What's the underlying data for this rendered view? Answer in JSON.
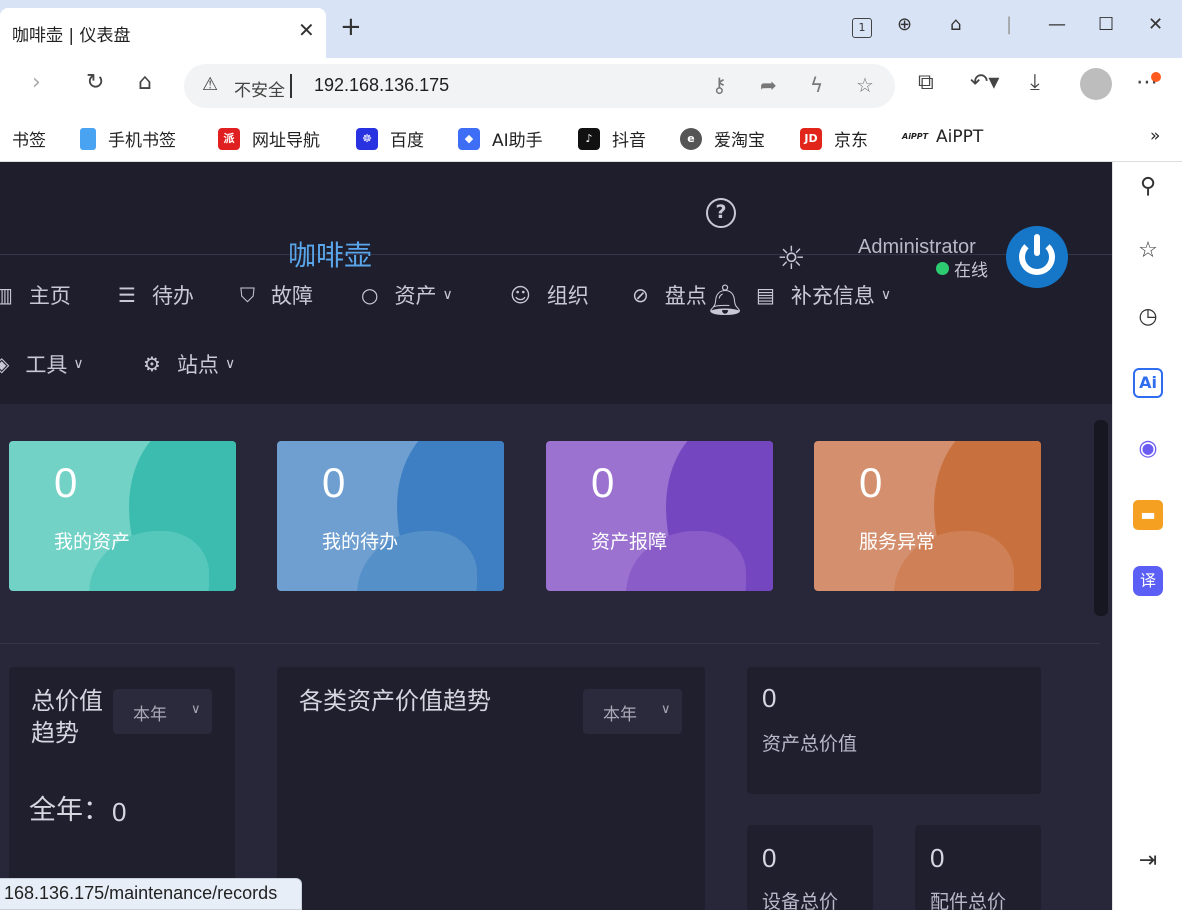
{
  "browser": {
    "tab_title": "咖啡壶 | 仪表盘",
    "tab_close": "✕",
    "new_tab": "+",
    "security_label": "不安全",
    "url": "192.168.136.175",
    "status_url": "168.136.175/maintenance/records",
    "bookmarks": [
      {
        "label": "书签",
        "icon": "",
        "color": ""
      },
      {
        "label": "手机书签",
        "icon": "phone-icon",
        "color": "#4aa3f0"
      },
      {
        "label": "网址导航",
        "icon": "nav-icon",
        "color": "#e02020"
      },
      {
        "label": "百度",
        "icon": "baidu-icon",
        "color": "#2932e1"
      },
      {
        "label": "AI助手",
        "icon": "ai-icon",
        "color": "#3d6ef5"
      },
      {
        "label": "抖音",
        "icon": "douyin-icon",
        "color": "#111111"
      },
      {
        "label": "爱淘宝",
        "icon": "taobao-icon",
        "color": "#555555"
      },
      {
        "label": "京东",
        "icon": "jd-icon",
        "color": "#e1251b"
      },
      {
        "label": "AiPPT",
        "icon": "aippt-icon",
        "color": "#222222"
      }
    ],
    "bookmarks_more": "»"
  },
  "app": {
    "logo": "咖啡壶",
    "user_name": "Administrator",
    "user_status": "在线",
    "nav": [
      {
        "label": "主页",
        "icon": "bar-chart-icon",
        "caret": false
      },
      {
        "label": "待办",
        "icon": "list-icon",
        "caret": false
      },
      {
        "label": "故障",
        "icon": "shield-icon",
        "caret": false
      },
      {
        "label": "资产",
        "icon": "circle-icon",
        "caret": true
      },
      {
        "label": "组织",
        "icon": "user-check-icon",
        "caret": false
      },
      {
        "label": "盘点",
        "icon": "check-circle-icon",
        "caret": false
      },
      {
        "label": "补充信息",
        "icon": "file-text-icon",
        "caret": true
      },
      {
        "label": "工具",
        "icon": "layers-icon",
        "caret": true
      },
      {
        "label": "站点",
        "icon": "gear-icon",
        "caret": true
      }
    ],
    "cards": [
      {
        "value": "0",
        "label": "我的资产",
        "bg": "#72d2c6",
        "dark": "#3bbcae"
      },
      {
        "value": "0",
        "label": "我的待办",
        "bg": "#6e9fd0",
        "dark": "#3d7fc2"
      },
      {
        "value": "0",
        "label": "资产报障",
        "bg": "#9b72d0",
        "dark": "#7447c0"
      },
      {
        "value": "0",
        "label": "服务异常",
        "bg": "#d4906e",
        "dark": "#c8703e"
      }
    ],
    "total_value_trend": {
      "title": "总价值趋势",
      "select": "本年",
      "year_label": "全年：",
      "year_value": "0"
    },
    "category_trend": {
      "title": "各类资产价值趋势",
      "select": "本年"
    },
    "stats": [
      {
        "value": "0",
        "label": "资产总价值"
      },
      {
        "value": "0",
        "label": "设备总价"
      },
      {
        "value": "0",
        "label": "配件总价"
      }
    ]
  }
}
